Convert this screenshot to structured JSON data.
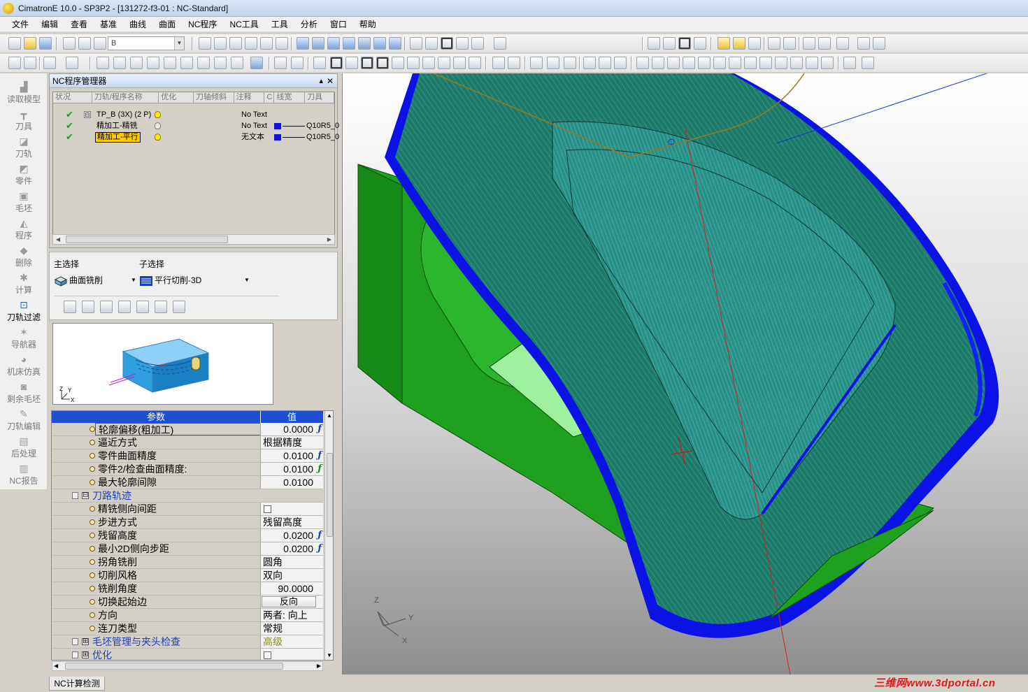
{
  "window": {
    "title": "CimatronE 10.0 - SP3P2 - [131272-f3-01 : NC-Standard]"
  },
  "menu": [
    "文件",
    "编辑",
    "查看",
    "基准",
    "曲线",
    "曲面",
    "NC程序",
    "NC工具",
    "工具",
    "分析",
    "窗口",
    "帮助"
  ],
  "toolbar": {
    "layer_combo": "B"
  },
  "left_panel": {
    "items": [
      {
        "label": "读取模型",
        "icon": "open-model-icon"
      },
      {
        "label": "刀具",
        "icon": "tool-icon"
      },
      {
        "label": "刀轨",
        "icon": "toolpath-icon"
      },
      {
        "label": "零件",
        "icon": "part-icon"
      },
      {
        "label": "毛坯",
        "icon": "stock-icon"
      },
      {
        "label": "程序",
        "icon": "program-icon"
      },
      {
        "label": "删除",
        "icon": "delete-icon"
      },
      {
        "label": "计算",
        "icon": "compute-icon"
      },
      {
        "label": "刀轨过滤",
        "icon": "filter-icon"
      },
      {
        "label": "导航器",
        "icon": "navigator-icon"
      },
      {
        "label": "机床仿真",
        "icon": "machine-sim-icon"
      },
      {
        "label": "剩余毛坯",
        "icon": "remaining-stock-icon"
      },
      {
        "label": "刀轨编辑",
        "icon": "toolpath-edit-icon"
      },
      {
        "label": "后处理",
        "icon": "post-process-icon"
      },
      {
        "label": "NC报告",
        "icon": "nc-report-icon"
      }
    ],
    "active_index": 8
  },
  "nc_manager": {
    "title": "NC程序管理器",
    "pin": "▴",
    "close": "✕",
    "columns": [
      "状况",
      "刀轨/程序名称",
      "优化",
      "刀轴倾斜",
      "注释",
      "C",
      "线宽",
      "刀具"
    ],
    "rows": [
      {
        "name": "TP_B (3X) (2 P)",
        "note": "No Text",
        "tool": "",
        "bulb": "on",
        "expand": "⊟"
      },
      {
        "name": "精加工-精铣",
        "note": "No Text",
        "tool": "Q10R5_0",
        "bulb": "off"
      },
      {
        "name": "精加工-平行",
        "note": "无文本",
        "tool": "Q10R5_0",
        "bulb": "on",
        "selected": true
      }
    ]
  },
  "selection": {
    "main_label": "主选择",
    "sub_label": "子选择",
    "main_value": "曲面铣削",
    "sub_value": "平行切削-3D"
  },
  "params": {
    "header_param": "参数",
    "header_value": "值",
    "rows": [
      {
        "name": "轮廓偏移(粗加工)",
        "value": "0.0000",
        "fx": "blue",
        "type": "num",
        "selected": true
      },
      {
        "name": "逼近方式",
        "value": "根据精度",
        "type": "text"
      },
      {
        "name": "零件曲面精度",
        "value": "0.0100",
        "fx": "blue",
        "type": "num"
      },
      {
        "name": "零件2/检查曲面精度:",
        "value": "0.0100",
        "fx": "green",
        "type": "num"
      },
      {
        "name": "最大轮廓间隙",
        "value": "0.0100",
        "type": "num"
      },
      {
        "name": "刀路轨迹",
        "group": true,
        "expand": "⊟"
      },
      {
        "name": "精铣侧向间距",
        "type": "check"
      },
      {
        "name": "步进方式",
        "value": "残留高度",
        "type": "text"
      },
      {
        "name": "残留高度",
        "value": "0.0200",
        "fx": "blue",
        "type": "num"
      },
      {
        "name": "最小2D侧向步距",
        "value": "0.0200",
        "fx": "blue",
        "type": "num"
      },
      {
        "name": "拐角铣削",
        "value": "圆角",
        "type": "text"
      },
      {
        "name": "切削风格",
        "value": "双向",
        "type": "text"
      },
      {
        "name": "铣削角度",
        "value": "90.0000",
        "type": "num"
      },
      {
        "name": "切换起始边",
        "value": "反向",
        "type": "button"
      },
      {
        "name": "方向",
        "value": "两者: 向上",
        "type": "text"
      },
      {
        "name": "连刀类型",
        "value": "常规",
        "type": "text"
      },
      {
        "name": "毛坯管理与夹头检查",
        "value": "高级",
        "group": true,
        "expand": "⊞",
        "type": "olive"
      },
      {
        "name": "优化",
        "group": true,
        "expand": "⊞",
        "type": "check"
      }
    ]
  },
  "bottom_tab": "NC计算检测",
  "preview_axes": {
    "z": "Z",
    "y": "Y",
    "x": "X"
  },
  "viewport_axes": {
    "z": "Z",
    "y": "Y",
    "x": "X"
  },
  "watermark": "三维网www.3dportal.cn",
  "colors": {
    "accent": "#1c4fd1",
    "selection": "#ffcc00",
    "part": "#1f9a1f",
    "toolpath": "#1010e0"
  }
}
